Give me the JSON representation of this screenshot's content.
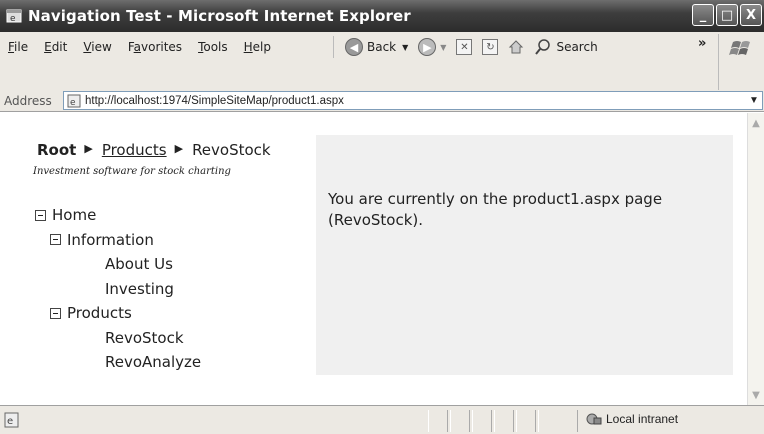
{
  "window": {
    "title": "Navigation Test - Microsoft Internet Explorer",
    "minimize": "_",
    "maximize": "□",
    "close": "X"
  },
  "menu": [
    {
      "label": "File",
      "accel": "F",
      "rest": "ile"
    },
    {
      "label": "Edit",
      "accel": "E",
      "rest": "dit"
    },
    {
      "label": "View",
      "accel": "V",
      "rest": "iew"
    },
    {
      "label": "Favorites",
      "pre": "F",
      "accel": "a",
      "rest": "vorites"
    },
    {
      "label": "Tools",
      "accel": "T",
      "rest": "ools"
    },
    {
      "label": "Help",
      "accel": "H",
      "rest": "elp"
    }
  ],
  "toolbar": {
    "back_label": "Back",
    "search_label": "Search",
    "more": "»"
  },
  "address": {
    "label": "Address",
    "url": "http://localhost:1974/SimpleSiteMap/product1.aspx"
  },
  "page": {
    "breadcrumb": {
      "root": "Root",
      "products": "Products",
      "current": "RevoStock",
      "separator": "▶"
    },
    "tagline": "Investment software for stock charting",
    "tree": {
      "home": "Home",
      "information": "Information",
      "about_us": "About Us",
      "investing": "Investing",
      "products": "Products",
      "revostock": "RevoStock",
      "revoanalyze": "RevoAnalyze"
    },
    "message": "You are currently on the product1.aspx page (RevoStock)."
  },
  "status": {
    "zone": "Local intranet"
  }
}
